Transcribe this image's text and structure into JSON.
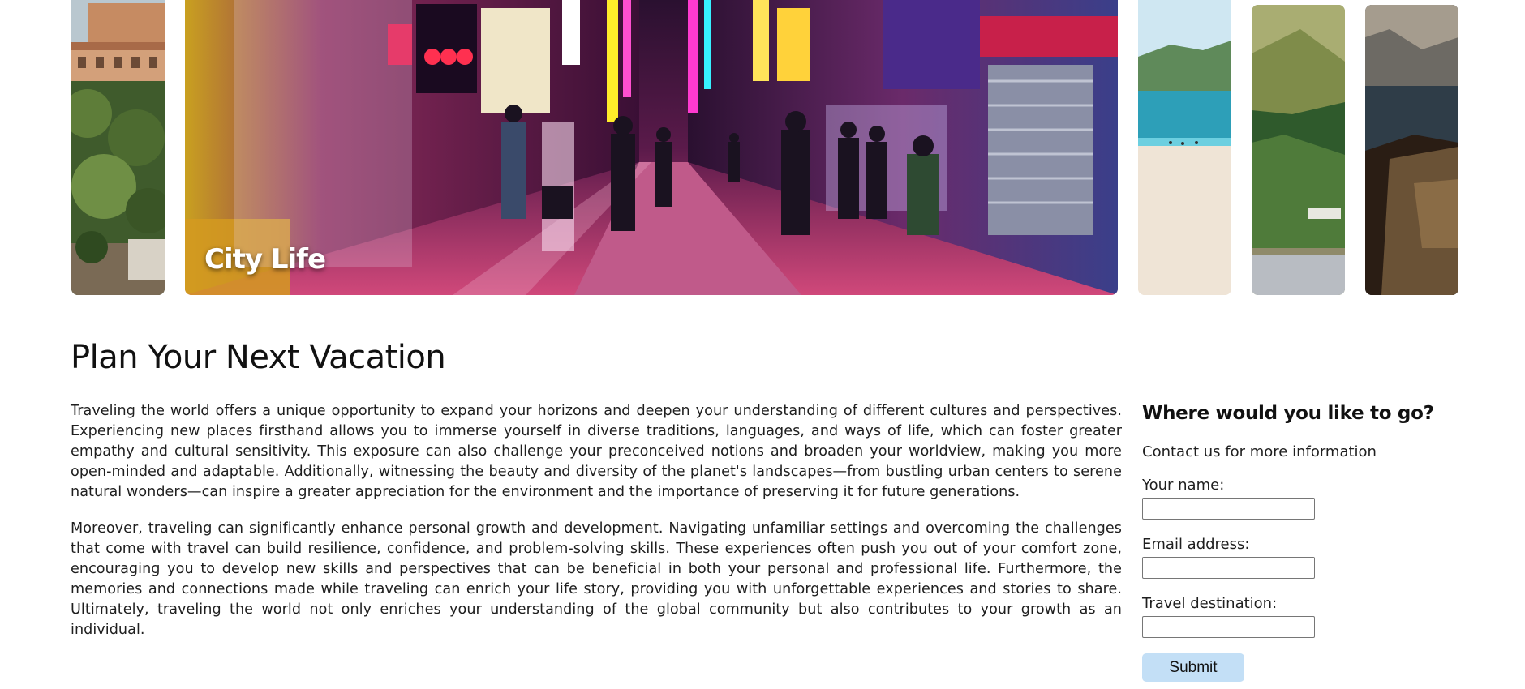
{
  "gallery": {
    "featured_caption": "City Life",
    "items": [
      {
        "name": "historic-town",
        "color": "#4f6b3d"
      },
      {
        "name": "city-life",
        "color": "#8a2b6b"
      },
      {
        "name": "beach",
        "color": "#3f9fbf"
      },
      {
        "name": "green-hills",
        "color": "#6f7e3d"
      },
      {
        "name": "coastal-cliffs",
        "color": "#5b4a3a"
      }
    ]
  },
  "main": {
    "title": "Plan Your Next Vacation",
    "paragraphs": [
      "Traveling the world offers a unique opportunity to expand your horizons and deepen your understanding of different cultures and perspectives. Experiencing new places firsthand allows you to immerse yourself in diverse traditions, languages, and ways of life, which can foster greater empathy and cultural sensitivity. This exposure can also challenge your preconceived notions and broaden your worldview, making you more open-minded and adaptable. Additionally, witnessing the beauty and diversity of the planet's landscapes—from bustling urban centers to serene natural wonders—can inspire a greater appreciation for the environment and the importance of preserving it for future generations.",
      "Moreover, traveling can significantly enhance personal growth and development. Navigating unfamiliar settings and overcoming the challenges that come with travel can build resilience, confidence, and problem-solving skills. These experiences often push you out of your comfort zone, encouraging you to develop new skills and perspectives that can be beneficial in both your personal and professional life. Furthermore, the memories and connections made while traveling can enrich your life story, providing you with unforgettable experiences and stories to share. Ultimately, traveling the world not only enriches your understanding of the global community but also contributes to your growth as an individual."
    ]
  },
  "form": {
    "title": "Where would you like to go?",
    "subtitle": "Contact us for more information",
    "name_label": "Your name:",
    "name_value": "",
    "email_label": "Email address:",
    "email_value": "",
    "destination_label": "Travel destination:",
    "destination_value": "",
    "submit_label": "Submit",
    "submit_color": "#c3dff6"
  }
}
